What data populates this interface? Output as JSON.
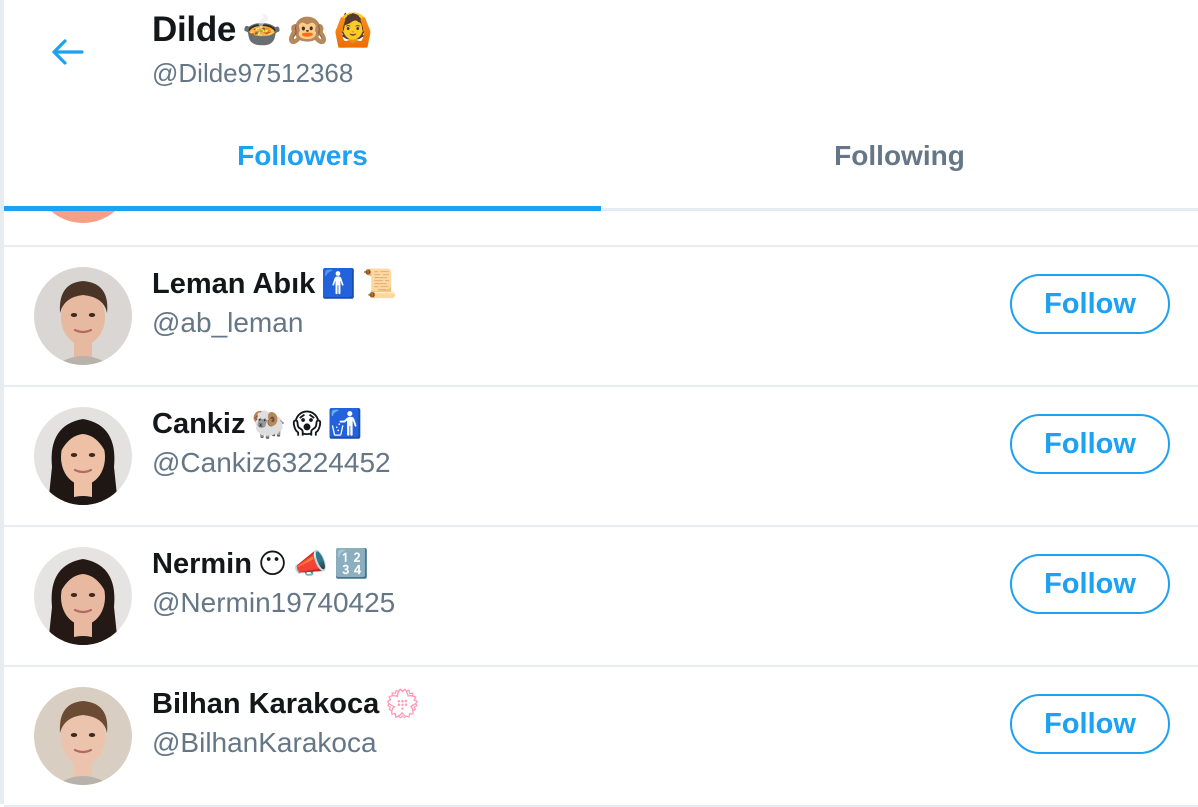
{
  "header": {
    "back_icon": "arrow-left-icon",
    "name": "Dilde",
    "name_emojis": [
      "🍲",
      "🙉",
      "🙆"
    ],
    "handle": "@Dilde97512368"
  },
  "tabs": [
    {
      "label": "Followers",
      "active": true
    },
    {
      "label": "Following",
      "active": false
    }
  ],
  "colors": {
    "accent": "#1da1f2",
    "text_primary": "#14171a",
    "text_secondary": "#657786",
    "divider": "#e6ecf0",
    "partial_avatar": "#f4a085"
  },
  "users": [
    {
      "name": "Leman Abık",
      "emojis": [
        "🚹",
        "📜"
      ],
      "handle": "@ab_leman",
      "follow_label": "Follow",
      "avatar": {
        "bg": "#d9d6d3",
        "skin": "#e7b9a0",
        "hair": "#4a3426",
        "hair_style": "short"
      }
    },
    {
      "name": "Cankiz",
      "emojis": [
        "🐏",
        "😱",
        "🚮"
      ],
      "handle": "@Cankiz63224452",
      "follow_label": "Follow",
      "avatar": {
        "bg": "#e4e2e0",
        "skin": "#eec0a6",
        "hair": "#1e1714",
        "hair_style": "long"
      }
    },
    {
      "name": "Nermin",
      "emojis": [
        "😶",
        "📣",
        "🔢"
      ],
      "handle": "@Nermin19740425",
      "follow_label": "Follow",
      "avatar": {
        "bg": "#e6e4e2",
        "skin": "#e9b8a0",
        "hair": "#241915",
        "hair_style": "long"
      }
    },
    {
      "name": "Bilhan Karakoca",
      "emojis": [
        "💮"
      ],
      "handle": "@BilhanKarakoca",
      "follow_label": "Follow",
      "avatar": {
        "bg": "#d8cfc2",
        "skin": "#ecc3ad",
        "hair": "#6b4b33",
        "hair_style": "short"
      }
    }
  ]
}
